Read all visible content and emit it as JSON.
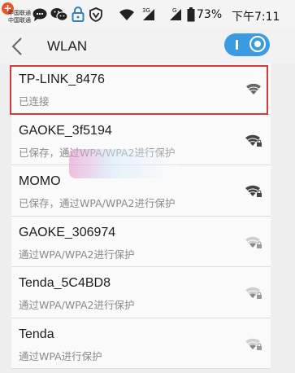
{
  "status_bar": {
    "carrier_line1": "中国联通",
    "carrier_line2": "中国联通",
    "network_type_1": "3G",
    "network_type_2": "G",
    "battery_percent": "73%",
    "time": "下午7:11"
  },
  "header": {
    "title": "WLAN",
    "wlan_enabled": true,
    "accent_color": "#3b9be0"
  },
  "networks": [
    {
      "ssid": "TP-LINK_8476",
      "status": "已连接",
      "signal_icon": "wifi-full-icon",
      "secured": false,
      "highlighted": true
    },
    {
      "ssid": "GAOKE_3f5194",
      "status": "已保存，通过WPA/WPA2进行保护",
      "signal_icon": "wifi-full-lock-icon",
      "secured": true
    },
    {
      "ssid": "MOMO",
      "status": "已保存，通过WPA/WPA2进行保护",
      "signal_icon": "wifi-full-lock-icon",
      "secured": true
    },
    {
      "ssid": "GAOKE_306974",
      "status": "通过WPA/WPA2进行保护",
      "signal_icon": "wifi-weak-lock-icon",
      "secured": true
    },
    {
      "ssid": "Tenda_5C4BD8",
      "status": "通过WPA/WPA2进行保护",
      "signal_icon": "wifi-weak-lock-icon",
      "secured": true
    },
    {
      "ssid": "Tenda",
      "status": "通过WPA进行保护",
      "signal_icon": "wifi-weak-lock-icon",
      "secured": true
    }
  ],
  "highlight_color": "#d33a3a"
}
